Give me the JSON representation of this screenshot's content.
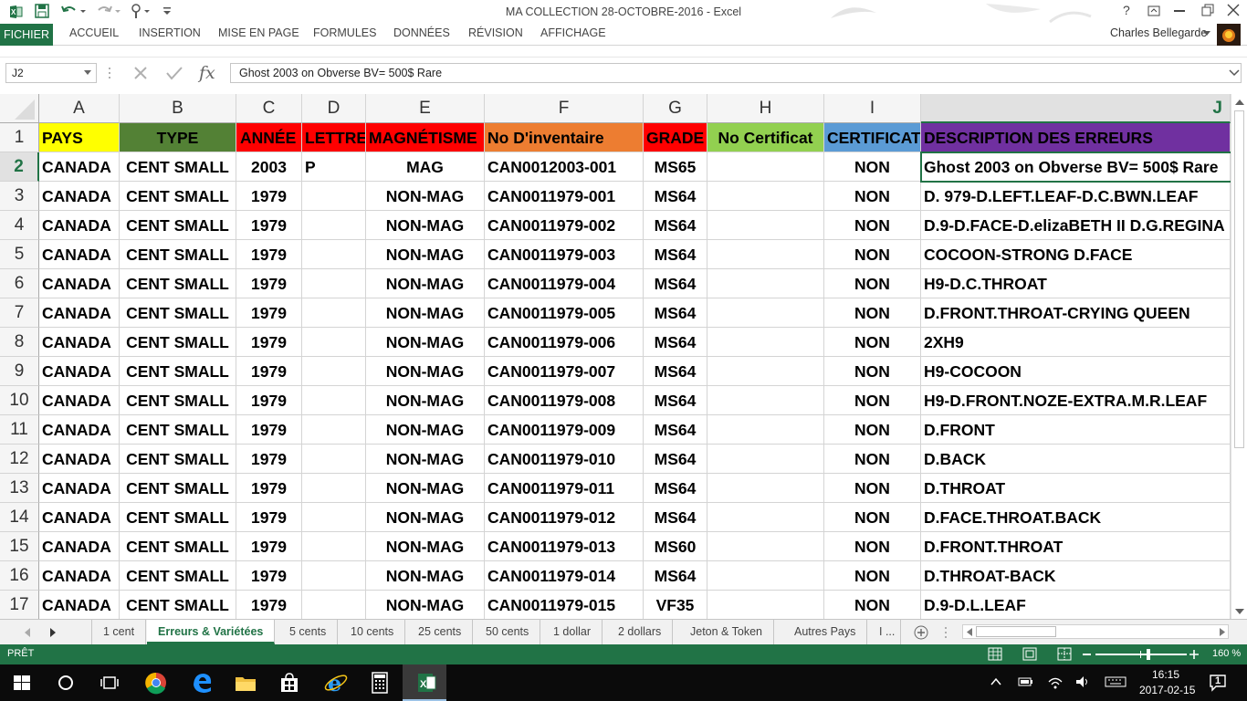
{
  "window": {
    "title": "MA COLLECTION 28-OCTOBRE-2016 - Excel",
    "user": "Charles Bellegarde"
  },
  "ribbon": {
    "tabs": [
      "FICHIER",
      "ACCUEIL",
      "INSERTION",
      "MISE EN PAGE",
      "FORMULES",
      "DONNÉES",
      "RÉVISION",
      "AFFICHAGE"
    ]
  },
  "formula_bar": {
    "name_box": "J2",
    "value": "Ghost 2003 on Obverse BV= 500$ Rare"
  },
  "columns": [
    "A",
    "B",
    "C",
    "D",
    "E",
    "F",
    "G",
    "H",
    "I",
    "J"
  ],
  "header_row": {
    "row_number": "1",
    "cells": [
      "PAYS",
      "TYPE",
      "ANNÉE",
      "LETTRE",
      "MAGNÉTISME",
      "No D'inventaire",
      "GRADE",
      "No Certificat",
      "CERTIFICAT",
      "DESCRIPTION DES ERREURS"
    ],
    "colors": [
      "#ffff00",
      "#538135",
      "#ff0000",
      "#ff0000",
      "#ff0000",
      "#ed7d31",
      "#ff0000",
      "#92d050",
      "#5b9bd5",
      "#7030a0"
    ]
  },
  "rows": [
    {
      "n": "2",
      "cells": [
        "CANADA",
        "CENT SMALL",
        "2003",
        "P",
        "MAG",
        "CAN0012003-001",
        "MS65",
        "",
        "NON",
        "Ghost 2003 on Obverse BV= 500$ Rare"
      ]
    },
    {
      "n": "3",
      "cells": [
        "CANADA",
        "CENT SMALL",
        "1979",
        "",
        "NON-MAG",
        "CAN0011979-001",
        "MS64",
        "",
        "NON",
        "D. 979-D.LEFT.LEAF-D.C.BWN.LEAF"
      ]
    },
    {
      "n": "4",
      "cells": [
        "CANADA",
        "CENT SMALL",
        "1979",
        "",
        "NON-MAG",
        "CAN0011979-002",
        "MS64",
        "",
        "NON",
        "D.9-D.FACE-D.elizaBETH II D.G.REGINA"
      ]
    },
    {
      "n": "5",
      "cells": [
        "CANADA",
        "CENT SMALL",
        "1979",
        "",
        "NON-MAG",
        "CAN0011979-003",
        "MS64",
        "",
        "NON",
        "COCOON-STRONG D.FACE"
      ]
    },
    {
      "n": "6",
      "cells": [
        "CANADA",
        "CENT SMALL",
        "1979",
        "",
        "NON-MAG",
        "CAN0011979-004",
        "MS64",
        "",
        "NON",
        "H9-D.C.THROAT"
      ]
    },
    {
      "n": "7",
      "cells": [
        "CANADA",
        "CENT SMALL",
        "1979",
        "",
        "NON-MAG",
        "CAN0011979-005",
        "MS64",
        "",
        "NON",
        "D.FRONT.THROAT-CRYING QUEEN"
      ]
    },
    {
      "n": "8",
      "cells": [
        "CANADA",
        "CENT SMALL",
        "1979",
        "",
        "NON-MAG",
        "CAN0011979-006",
        "MS64",
        "",
        "NON",
        "2XH9"
      ]
    },
    {
      "n": "9",
      "cells": [
        "CANADA",
        "CENT SMALL",
        "1979",
        "",
        "NON-MAG",
        "CAN0011979-007",
        "MS64",
        "",
        "NON",
        "H9-COCOON"
      ]
    },
    {
      "n": "10",
      "cells": [
        "CANADA",
        "CENT SMALL",
        "1979",
        "",
        "NON-MAG",
        "CAN0011979-008",
        "MS64",
        "",
        "NON",
        "H9-D.FRONT.NOZE-EXTRA.M.R.LEAF"
      ]
    },
    {
      "n": "11",
      "cells": [
        "CANADA",
        "CENT SMALL",
        "1979",
        "",
        "NON-MAG",
        "CAN0011979-009",
        "MS64",
        "",
        "NON",
        "D.FRONT"
      ]
    },
    {
      "n": "12",
      "cells": [
        "CANADA",
        "CENT SMALL",
        "1979",
        "",
        "NON-MAG",
        "CAN0011979-010",
        "MS64",
        "",
        "NON",
        "D.BACK"
      ]
    },
    {
      "n": "13",
      "cells": [
        "CANADA",
        "CENT SMALL",
        "1979",
        "",
        "NON-MAG",
        "CAN0011979-011",
        "MS64",
        "",
        "NON",
        "D.THROAT"
      ]
    },
    {
      "n": "14",
      "cells": [
        "CANADA",
        "CENT SMALL",
        "1979",
        "",
        "NON-MAG",
        "CAN0011979-012",
        "MS64",
        "",
        "NON",
        "D.FACE.THROAT.BACK"
      ]
    },
    {
      "n": "15",
      "cells": [
        "CANADA",
        "CENT SMALL",
        "1979",
        "",
        "NON-MAG",
        "CAN0011979-013",
        "MS60",
        "",
        "NON",
        "D.FRONT.THROAT"
      ]
    },
    {
      "n": "16",
      "cells": [
        "CANADA",
        "CENT SMALL",
        "1979",
        "",
        "NON-MAG",
        "CAN0011979-014",
        "MS64",
        "",
        "NON",
        "D.THROAT-BACK"
      ]
    },
    {
      "n": "17",
      "cells": [
        "CANADA",
        "CENT SMALL",
        "1979",
        "",
        "NON-MAG",
        "CAN0011979-015",
        "VF35",
        "",
        "NON",
        "D.9-D.L.LEAF"
      ]
    }
  ],
  "sheet_tabs": [
    "1 cent",
    "Erreurs & Variétées",
    "5 cents",
    "10 cents",
    "25 cents",
    "50 cents",
    "1 dollar",
    "2 dollars",
    "Jeton & Token",
    "Autres Pays",
    "I ..."
  ],
  "active_sheet": "Erreurs & Variétées",
  "status": {
    "ready": "PRÊT",
    "zoom": "160 %"
  },
  "taskbar": {
    "time": "16:15",
    "date": "2017-02-15",
    "notifications": "1"
  }
}
